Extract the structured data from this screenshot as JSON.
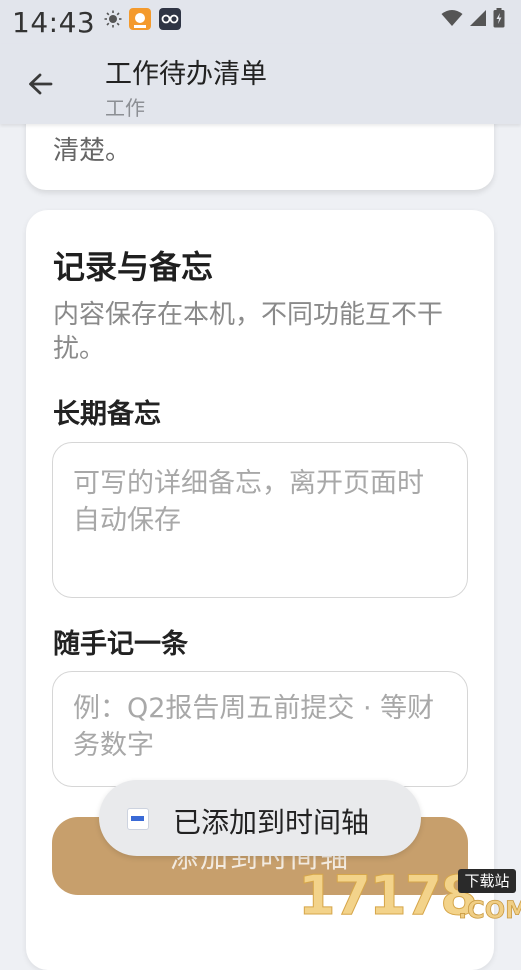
{
  "status_bar": {
    "time": "14:43",
    "left_icons": [
      "brightness-icon",
      "app-notification-icon",
      "app-notification-icon-2"
    ],
    "right_icons": [
      "wifi-icon",
      "signal-icon",
      "battery-icon"
    ]
  },
  "app_bar": {
    "title": "工作待办清单",
    "subtitle": "工作"
  },
  "previous_card": {
    "tail_text": "清楚。"
  },
  "notes_card": {
    "title": "记录与备忘",
    "description": "内容保存在本机，不同功能互不干扰。",
    "long_memo": {
      "label": "长期备忘",
      "placeholder": "可写的详细备忘，离开页面时自动保存",
      "value": ""
    },
    "quick_note": {
      "label": "随手记一条",
      "placeholder": "例：Q2报告周五前提交 · 等财务数字",
      "value": ""
    },
    "add_button_label": "添加到时间轴"
  },
  "toast": {
    "text": "已添加到时间轴"
  },
  "watermark": {
    "number": "17178",
    "domain": ".COM",
    "tag": "下载站"
  },
  "colors": {
    "accent": "#c79f6c",
    "app_bar_bg": "#e2e5ec",
    "page_bg": "#eef0f4"
  }
}
